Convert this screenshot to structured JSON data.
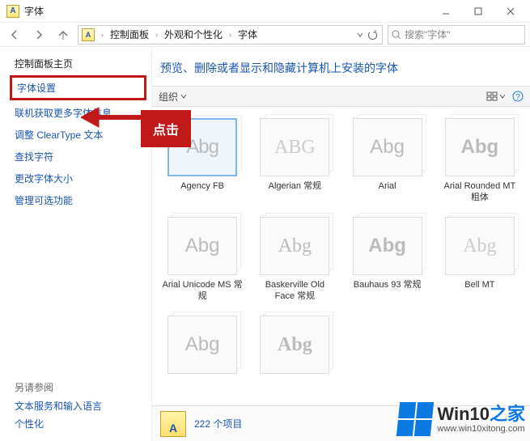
{
  "window": {
    "title": "字体"
  },
  "breadcrumb": {
    "parts": [
      "控制面板",
      "外观和个性化",
      "字体"
    ]
  },
  "search": {
    "placeholder": "搜索\"字体\""
  },
  "sidebar": {
    "heading": "控制面板主页",
    "items": [
      "字体设置",
      "联机获取更多字体信息",
      "调整 ClearType 文本",
      "查找字符",
      "更改字体大小",
      "管理可选功能"
    ],
    "see_also_heading": "另请参阅",
    "see_also": [
      "文本服务和输入语言",
      "个性化"
    ]
  },
  "banner": "预览、删除或者显示和隐藏计算机上安装的字体",
  "toolbar": {
    "organize": "组织"
  },
  "fonts": [
    {
      "name": "Agency FB",
      "sample": "Abg",
      "class": "sample-agency",
      "selected": true
    },
    {
      "name": "Algerian 常规",
      "sample": "ABG",
      "class": "sample-algerian"
    },
    {
      "name": "Arial",
      "sample": "Abg",
      "class": "sample-arial"
    },
    {
      "name": "Arial Rounded MT 粗体",
      "sample": "Abg",
      "class": "sample-rounded"
    },
    {
      "name": "Arial Unicode MS 常规",
      "sample": "Abg",
      "class": "sample-unimono"
    },
    {
      "name": "Baskerville Old Face 常规",
      "sample": "Abg",
      "class": "sample-basker"
    },
    {
      "name": "Bauhaus 93 常规",
      "sample": "Abg",
      "class": "sample-bauhaus"
    },
    {
      "name": "Bell MT",
      "sample": "Abg",
      "class": "sample-bellmt"
    },
    {
      "name": "",
      "sample": "Abg",
      "class": "sample-r3a"
    },
    {
      "name": "",
      "sample": "Abg",
      "class": "sample-r3b"
    }
  ],
  "status": {
    "count": "222 个项目"
  },
  "annotation": {
    "text": "点击"
  },
  "watermark": {
    "brand_a": "Win10",
    "brand_b": "之家",
    "url": "www.win10xitong.com"
  }
}
